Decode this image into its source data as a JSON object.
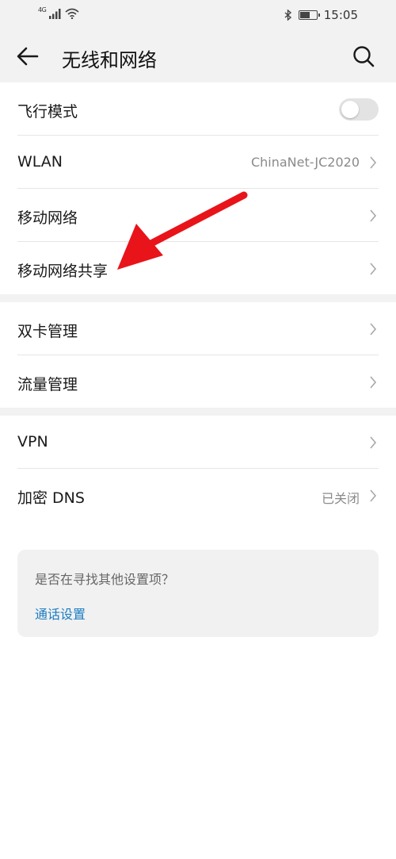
{
  "status_bar": {
    "network_type": "4G",
    "time": "15:05",
    "battery_level": 0.6,
    "icons": [
      "signal-icon",
      "wifi-icon",
      "bluetooth-icon",
      "battery-icon"
    ]
  },
  "header": {
    "title": "无线和网络",
    "back_icon": "back-arrow-icon",
    "search_icon": "search-icon"
  },
  "groups": [
    {
      "items": [
        {
          "label": "飞行模式",
          "type": "toggle",
          "on": false
        },
        {
          "label": "WLAN",
          "value": "ChinaNet-JC2020",
          "type": "nav"
        },
        {
          "label": "移动网络",
          "type": "nav"
        },
        {
          "label": "移动网络共享",
          "type": "nav"
        }
      ]
    },
    {
      "items": [
        {
          "label": "双卡管理",
          "type": "nav"
        },
        {
          "label": "流量管理",
          "type": "nav"
        }
      ]
    },
    {
      "items": [
        {
          "label": "VPN",
          "type": "nav"
        },
        {
          "label": "加密 DNS",
          "value": "已关闭",
          "type": "nav"
        }
      ]
    }
  ],
  "suggestion": {
    "question": "是否在寻找其他设置项？",
    "link": "通话设置"
  },
  "colors": {
    "background": "#ffffff",
    "band": "#f2f2f2",
    "link": "#1a7dc2",
    "annotation_arrow": "#e8141a"
  }
}
